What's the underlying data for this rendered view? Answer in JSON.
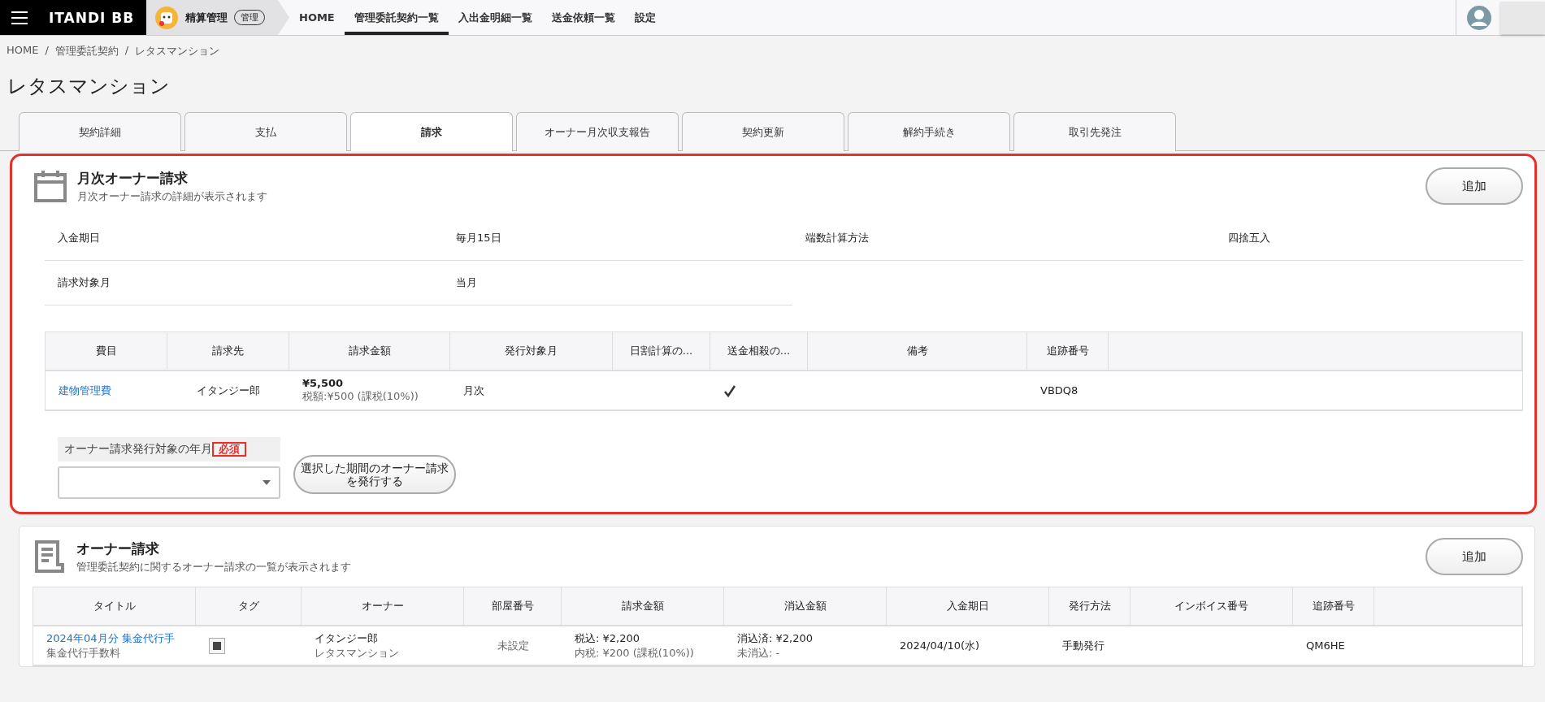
{
  "topbar": {
    "brand": "ITANDI BB",
    "app": {
      "name": "精算管理",
      "badge": "管理"
    },
    "nav": [
      {
        "label": "HOME",
        "selected": false
      },
      {
        "label": "管理委託契約一覧",
        "selected": true
      },
      {
        "label": "入出金明細一覧",
        "selected": false
      },
      {
        "label": "送金依頼一覧",
        "selected": false
      },
      {
        "label": "設定",
        "selected": false
      }
    ]
  },
  "breadcrumb": {
    "separator": "/",
    "items": [
      "HOME",
      "管理委託契約",
      "レタスマンション"
    ]
  },
  "page_title": "レタスマンション",
  "tabs": [
    {
      "label": "契約詳細",
      "selected": false
    },
    {
      "label": "支払",
      "selected": false
    },
    {
      "label": "請求",
      "selected": true
    },
    {
      "label": "オーナー月次収支報告",
      "selected": false
    },
    {
      "label": "契約更新",
      "selected": false
    },
    {
      "label": "解約手続き",
      "selected": false
    },
    {
      "label": "取引先発注",
      "selected": false
    }
  ],
  "monthly_section": {
    "highlighted": true,
    "title": "月次オーナー請求",
    "subtitle": "月次オーナー請求の詳細が表示されます",
    "add_button": "追加",
    "details": [
      {
        "label": "入金期日",
        "value": "毎月15日"
      },
      {
        "label": "端数計算方法",
        "value": "四捨五入"
      },
      {
        "label": "請求対象月",
        "value": "当月"
      }
    ],
    "table": {
      "columns": [
        "費目",
        "請求先",
        "請求金額",
        "発行対象月",
        "日割計算の...",
        "送金相殺の...",
        "備考",
        "追跡番号"
      ],
      "rows": [
        {
          "item": "建物管理費",
          "payee": "イタンジー郎",
          "amount": "¥5,500",
          "tax": "税額:¥500 (課税(10%))",
          "issue_month": "月次",
          "offset": true,
          "tracking": "VBDQ8"
        }
      ]
    },
    "period_field": {
      "label": "オーナー請求発行対象の年月",
      "required": "必須"
    },
    "issue_button": "選択した期間のオーナー請求を発行する"
  },
  "owner_section": {
    "title": "オーナー請求",
    "subtitle": "管理委託契約に関するオーナー請求の一覧が表示されます",
    "add_button": "追加",
    "table": {
      "columns": [
        "タイトル",
        "タグ",
        "オーナー",
        "部屋番号",
        "請求金額",
        "消込金額",
        "入金期日",
        "発行方法",
        "インボイス番号",
        "追跡番号"
      ],
      "rows": [
        {
          "title": "2024年04月分 集金代行手",
          "subtitle": "集金代行手数料",
          "tagged": true,
          "owner": "イタンジー郎",
          "property": "レタスマンション",
          "room": "未設定",
          "amount": "税込: ¥2,200",
          "tax": "内税: ¥200 (課税(10%))",
          "cleared": "消込済: ¥2,200",
          "uncleared": "未消込: -",
          "due": "2024/04/10(水)",
          "method": "手動発行",
          "tracking": "QM6HE"
        }
      ]
    }
  }
}
